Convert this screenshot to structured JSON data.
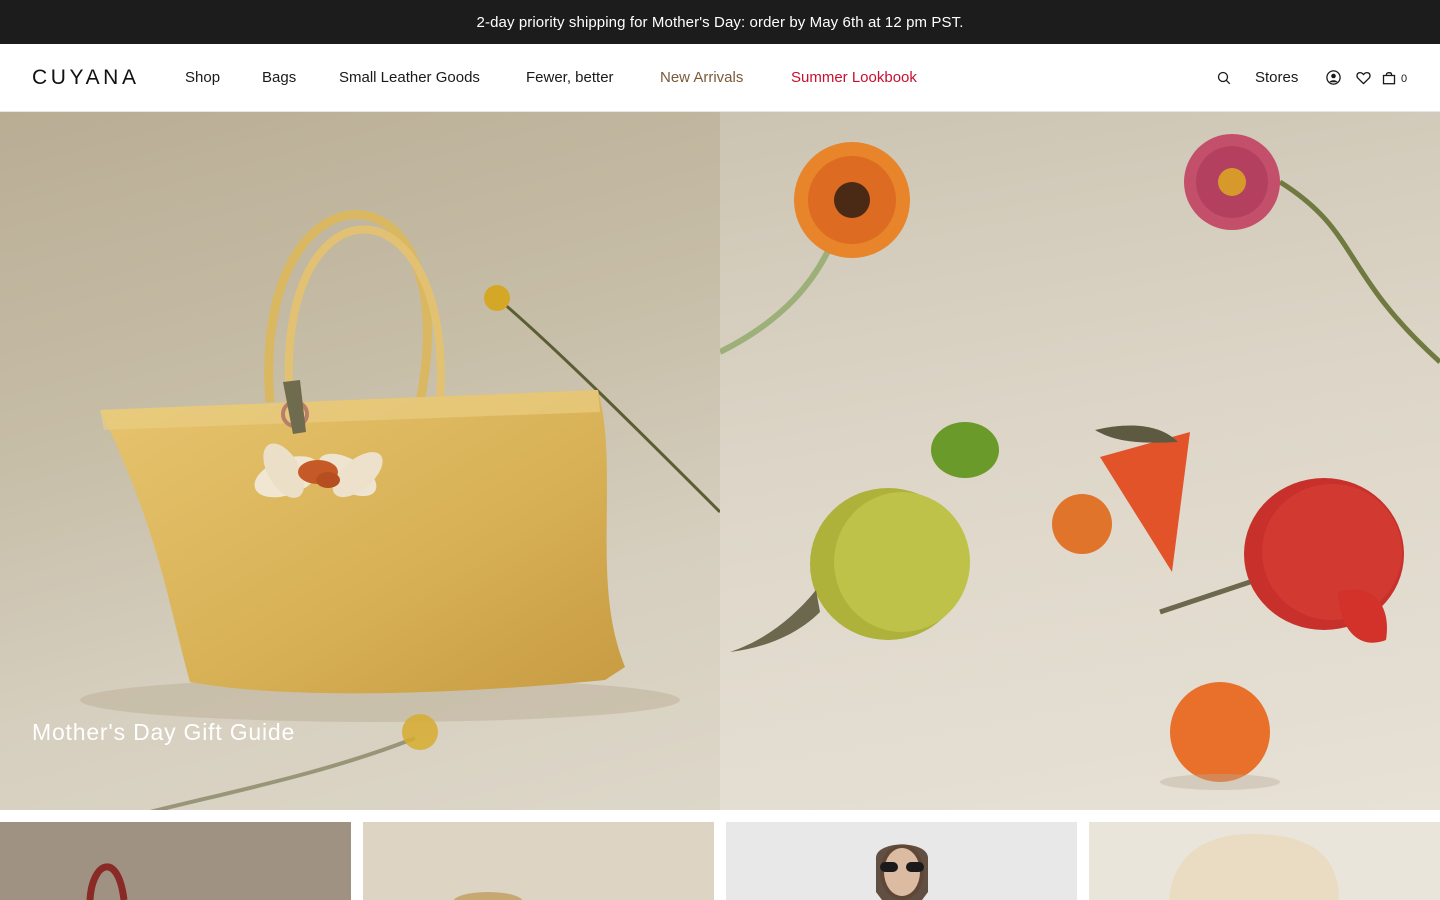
{
  "promo": {
    "text": "2-day priority shipping for Mother's Day: order by May 6th at 12 pm PST."
  },
  "header": {
    "logo": "CUYANA",
    "nav": [
      {
        "label": "Shop"
      },
      {
        "label": "Bags"
      },
      {
        "label": "Small Leather Goods"
      },
      {
        "label": "Fewer, better"
      },
      {
        "label": "New Arrivals",
        "color": "#7a5a3a"
      },
      {
        "label": "Summer Lookbook",
        "color": "#c8102e"
      }
    ],
    "utility": {
      "search_icon": "search-icon",
      "stores_label": "Stores",
      "account_icon": "user-icon",
      "wishlist_icon": "heart-icon",
      "cart_icon": "bag-icon",
      "cart_count": "0"
    }
  },
  "hero": {
    "left": {
      "caption": "Mother's Day Gift Guide",
      "image": "yellow leather tote with leather flower charm and billy button flowers"
    },
    "right": {
      "image": "colorful leather coin pouches with gerbera daisies, lime, oranges and strawberry"
    }
  },
  "tiles": [
    {
      "image": "burgundy leather bag on taupe background"
    },
    {
      "image": "tan leather bag on cream background"
    },
    {
      "image": "model wearing sunglasses on light grey background"
    },
    {
      "image": "straw bucket hat on cream background"
    }
  ],
  "colors": {
    "promo_bg": "#1c1c1c",
    "accent_brown": "#7a5a3a",
    "accent_red": "#c8102e"
  }
}
